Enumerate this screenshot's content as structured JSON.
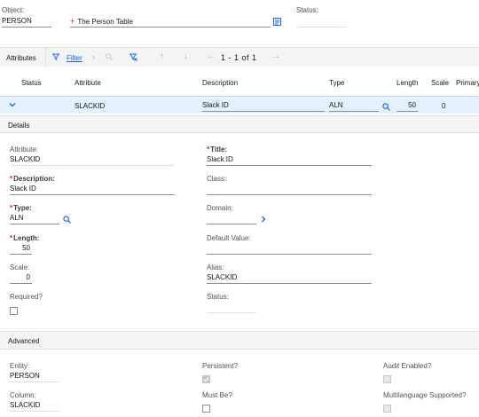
{
  "header": {
    "object_label": "Object:",
    "object_value": "PERSON",
    "description_value": "The Person Table",
    "status_label": "Status:",
    "status_value": ""
  },
  "toolbar": {
    "title": "Attributes",
    "filter_label": "Filter",
    "pagination": "1 - 1 of 1"
  },
  "table": {
    "columns": [
      "Status",
      "Attribute",
      "Description",
      "Type",
      "Length",
      "Scale",
      "Primary"
    ],
    "row": {
      "attribute": "SLACKID",
      "description": "Slack ID",
      "type": "ALN",
      "length": "50",
      "scale": "0"
    }
  },
  "details": {
    "section_title": "Details",
    "attribute_label": "Attribute:",
    "attribute_value": "SLACKID",
    "title_label": "Title:",
    "title_value": "Slack ID",
    "description_label": "Description:",
    "description_value": "Slack ID",
    "class_label": "Class:",
    "class_value": "",
    "type_label": "Type:",
    "type_value": "ALN",
    "domain_label": "Domain:",
    "domain_value": "",
    "length_label": "Length:",
    "length_value": "50",
    "default_label": "Default Value:",
    "default_value": "",
    "scale_label": "Scale:",
    "scale_value": "0",
    "alias_label": "Alias:",
    "alias_value": "SLACKID",
    "required_label": "Required?",
    "status_label": "Status:",
    "status_value": ""
  },
  "advanced": {
    "section_title": "Advanced",
    "entity_label": "Entity:",
    "entity_value": "PERSON",
    "persistent_label": "Persistent?",
    "audit_label": "Audit Enabled?",
    "column_label": "Column:",
    "column_value": "SLACKID",
    "mustbe_label": "Must Be?",
    "multilang_label": "Multilanguage Supported?"
  },
  "colors": {
    "accent": "#0f62fe",
    "selected_row": "#e5f0ff",
    "required": "#da1e28"
  }
}
